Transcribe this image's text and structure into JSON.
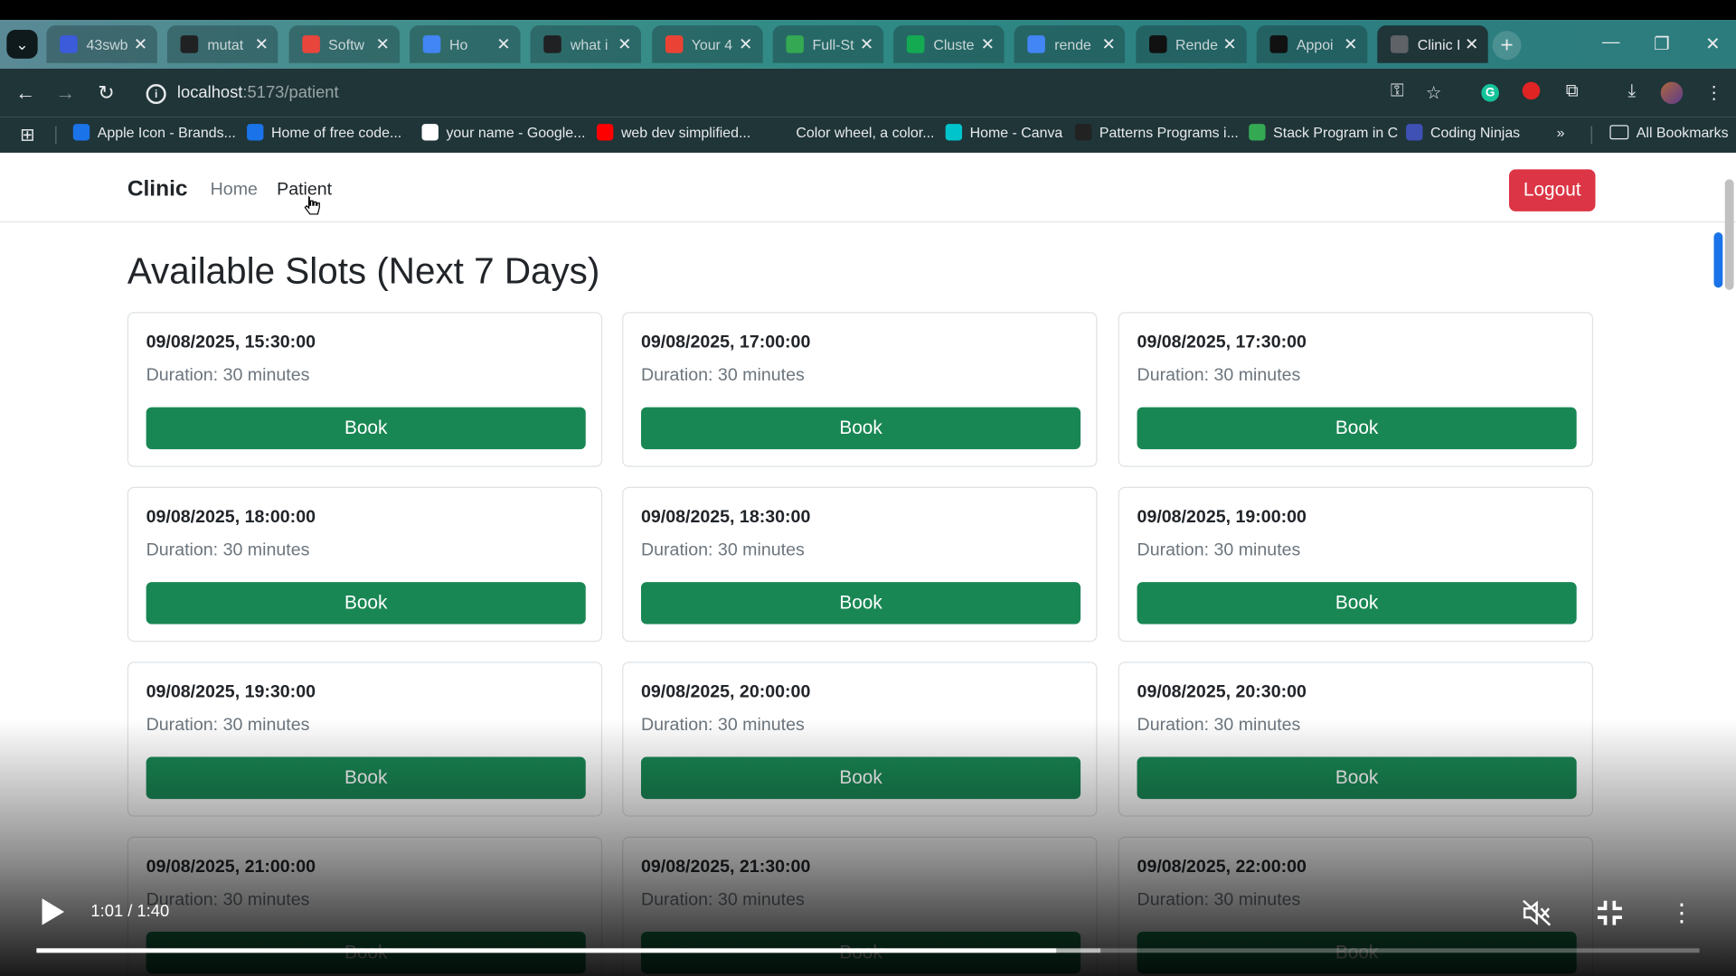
{
  "browser": {
    "tabs": [
      {
        "title": "43swb",
        "icon": "code-icon",
        "color": "#3b5bdb"
      },
      {
        "title": "mutat",
        "icon": "chatgpt-icon",
        "color": "#202123"
      },
      {
        "title": "Softw",
        "icon": "chrome-icon",
        "color": "#e8453c"
      },
      {
        "title": "Ho",
        "icon": "docs-icon",
        "color": "#4285f4"
      },
      {
        "title": "what i",
        "icon": "chatgpt-icon",
        "color": "#202123"
      },
      {
        "title": "Your 4",
        "icon": "gmail-icon",
        "color": "#ea4335"
      },
      {
        "title": "Full-St",
        "icon": "drive-icon",
        "color": "#34a853"
      },
      {
        "title": "Cluste",
        "icon": "mongodb-icon",
        "color": "#13aa52"
      },
      {
        "title": "rende",
        "icon": "google-icon",
        "color": "#4285f4"
      },
      {
        "title": "Rende",
        "icon": "render-icon",
        "color": "#111111"
      },
      {
        "title": "Appoi",
        "icon": "github-icon",
        "color": "#111111"
      },
      {
        "title": "Clinic I",
        "icon": "globe-icon",
        "color": "#5f6368"
      }
    ],
    "close_glyph": "✕",
    "url_host": "localhost",
    "url_path": ":5173/patient",
    "bookmarks": [
      {
        "label": "Apple Icon - Brands...",
        "color": "#1a73e8"
      },
      {
        "label": "Home of free code...",
        "color": "#1a73e8"
      },
      {
        "label": "your name - Google...",
        "color": "#ffffff"
      },
      {
        "label": "web dev simplified...",
        "color": "#ff0000"
      },
      {
        "label": "Color wheel, a color...",
        "color": "#1f3538"
      },
      {
        "label": "Home - Canva",
        "color": "#00c4cc"
      },
      {
        "label": "Patterns Programs i...",
        "color": "#222222"
      },
      {
        "label": "Stack Program in C",
        "color": "#34a853"
      },
      {
        "label": "Coding Ninjas",
        "color": "#3f51b5"
      }
    ],
    "more_bookmarks": "»",
    "all_bookmarks": "All Bookmarks"
  },
  "app": {
    "brand": "Clinic",
    "nav": [
      "Home",
      "Patient"
    ],
    "logout": "Logout",
    "heading": "Available Slots (Next 7 Days)",
    "book_label": "Book",
    "slots": [
      {
        "datetime": "09/08/2025, 15:30:00",
        "duration": "Duration: 30 minutes"
      },
      {
        "datetime": "09/08/2025, 17:00:00",
        "duration": "Duration: 30 minutes"
      },
      {
        "datetime": "09/08/2025, 17:30:00",
        "duration": "Duration: 30 minutes"
      },
      {
        "datetime": "09/08/2025, 18:00:00",
        "duration": "Duration: 30 minutes"
      },
      {
        "datetime": "09/08/2025, 18:30:00",
        "duration": "Duration: 30 minutes"
      },
      {
        "datetime": "09/08/2025, 19:00:00",
        "duration": "Duration: 30 minutes"
      },
      {
        "datetime": "09/08/2025, 19:30:00",
        "duration": "Duration: 30 minutes"
      },
      {
        "datetime": "09/08/2025, 20:00:00",
        "duration": "Duration: 30 minutes"
      },
      {
        "datetime": "09/08/2025, 20:30:00",
        "duration": "Duration: 30 minutes"
      },
      {
        "datetime": "09/08/2025, 21:00:00",
        "duration": "Duration: 30 minutes"
      },
      {
        "datetime": "09/08/2025, 21:30:00",
        "duration": "Duration: 30 minutes"
      },
      {
        "datetime": "09/08/2025, 22:00:00",
        "duration": "Duration: 30 minutes"
      }
    ],
    "colors": {
      "book": "#198754",
      "logout": "#dc3545"
    }
  },
  "video": {
    "time": "1:01 / 1:40",
    "progress": 0.613,
    "buffered": 0.64,
    "muted": true
  }
}
